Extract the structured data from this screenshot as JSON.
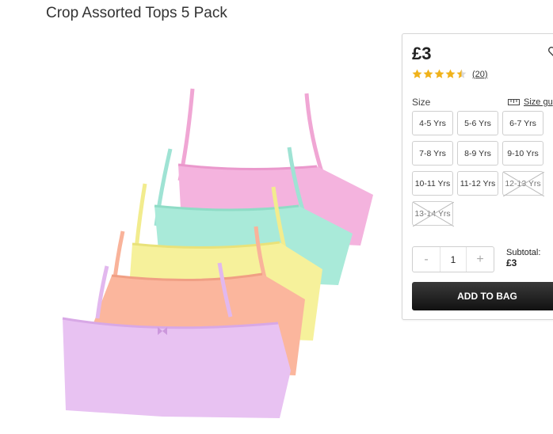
{
  "product": {
    "title": "Crop Assorted Tops 5 Pack"
  },
  "purchase": {
    "price": "£3",
    "rating": 4.5,
    "rating_max": 5,
    "review_count": "(20)",
    "size_label": "Size",
    "size_guide_label": "Size gu",
    "sizes": [
      {
        "label": "4-5 Yrs",
        "available": true
      },
      {
        "label": "5-6 Yrs",
        "available": true
      },
      {
        "label": "6-7 Yrs",
        "available": true
      },
      {
        "label": "7-8 Yrs",
        "available": true
      },
      {
        "label": "8-9 Yrs",
        "available": true
      },
      {
        "label": "9-10 Yrs",
        "available": true
      },
      {
        "label": "10-11 Yrs",
        "available": true
      },
      {
        "label": "11-12 Yrs",
        "available": true
      },
      {
        "label": "12-13 Yrs",
        "available": false
      },
      {
        "label": "13-14 Yrs",
        "available": false
      }
    ],
    "quantity": {
      "minus": "-",
      "value": "1",
      "plus": "+"
    },
    "subtotal_label": "Subtotal:",
    "subtotal_value": "£3",
    "add_to_bag": "ADD TO BAG",
    "accent_star": "#f0b21a"
  }
}
